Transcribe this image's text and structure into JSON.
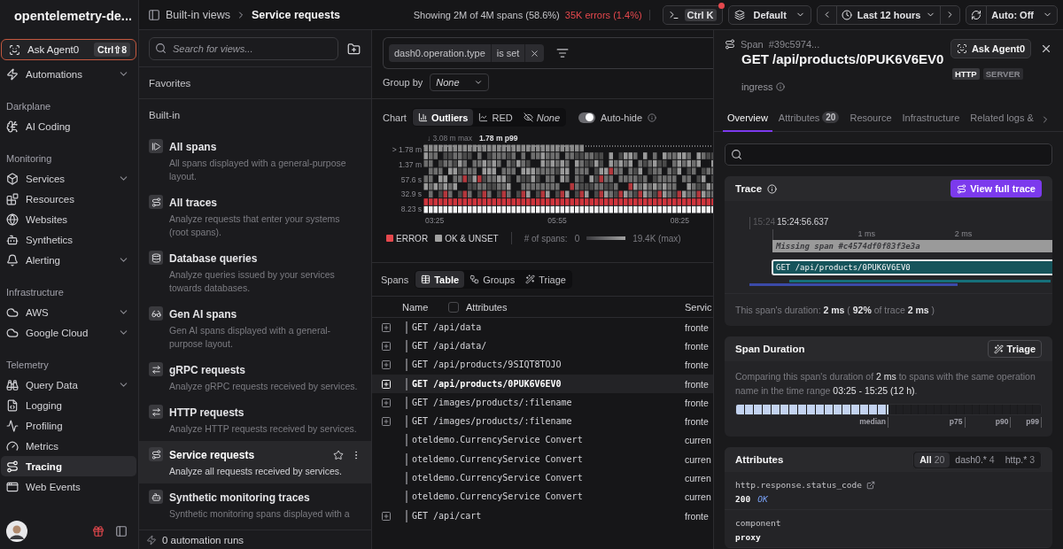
{
  "app": {
    "name": "opentelemetry-de..."
  },
  "sidebar": {
    "ask": {
      "label": "Ask Agent0",
      "shortcut": "Ctrl⇧8"
    },
    "top_items": [
      {
        "label": "Automations",
        "collapsible": true,
        "selected": false
      }
    ],
    "sections": [
      {
        "title": "Darkplane",
        "items": [
          {
            "label": "AI Coding",
            "collapsible": false,
            "selected": false
          }
        ]
      },
      {
        "title": "Monitoring",
        "items": [
          {
            "label": "Services",
            "collapsible": true,
            "selected": false
          },
          {
            "label": "Resources",
            "collapsible": false,
            "selected": false
          },
          {
            "label": "Websites",
            "collapsible": false,
            "selected": false
          },
          {
            "label": "Synthetics",
            "collapsible": false,
            "selected": false
          },
          {
            "label": "Alerting",
            "collapsible": true,
            "selected": false
          }
        ]
      },
      {
        "title": "Infrastructure",
        "items": [
          {
            "label": "AWS",
            "collapsible": true,
            "selected": false
          },
          {
            "label": "Google Cloud",
            "collapsible": true,
            "selected": false
          }
        ]
      },
      {
        "title": "Telemetry",
        "items": [
          {
            "label": "Query Data",
            "collapsible": true,
            "selected": false
          },
          {
            "label": "Logging",
            "collapsible": false,
            "selected": false
          },
          {
            "label": "Profiling",
            "collapsible": false,
            "selected": false
          },
          {
            "label": "Metrics",
            "collapsible": false,
            "selected": false
          },
          {
            "label": "Tracing",
            "collapsible": false,
            "selected": true
          },
          {
            "label": "Web Events",
            "collapsible": false,
            "selected": false
          }
        ]
      }
    ]
  },
  "breadcrumb": [
    "Built-in views",
    "Service requests"
  ],
  "stats": {
    "showing": "Showing 2M of 4M spans (58.6%)",
    "errors": "35K errors (1.4%)"
  },
  "toolbar": {
    "command": "Ctrl K",
    "view": "Default",
    "time_range": "Last 12 hours",
    "refresh": "Auto: Off"
  },
  "views": {
    "search": {
      "placeholder": "Search for views..."
    },
    "favorites_title": "Favorites",
    "builtin_title": "Built-in",
    "items": [
      {
        "title": "All spans",
        "description": "All spans displayed with a general-purpose layout.",
        "selected": false
      },
      {
        "title": "All traces",
        "description": "Analyze requests that enter your systems (root spans).",
        "selected": false
      },
      {
        "title": "Database queries",
        "description": "Analyze queries issued by your services towards databases.",
        "selected": false
      },
      {
        "title": "Gen AI spans",
        "description": "Gen AI spans displayed with a general-purpose layout.",
        "selected": false
      },
      {
        "title": "gRPC requests",
        "description": "Analyze gRPC requests received by services.",
        "selected": false
      },
      {
        "title": "HTTP requests",
        "description": "Analyze HTTP requests received by services.",
        "selected": false
      },
      {
        "title": "Service requests",
        "description": "Analyze all requests received by services.",
        "selected": true
      },
      {
        "title": "Synthetic monitoring traces",
        "description": "Synthetic monitoring spans displayed with a",
        "selected": false
      }
    ],
    "footer": "0 automation runs"
  },
  "filter": {
    "key": "dash0.operation.type",
    "op": "is set"
  },
  "group_by": {
    "label": "Group by",
    "value": "None"
  },
  "chart": {
    "label": "Chart",
    "modes": [
      {
        "label": "Outliers",
        "selected": true
      },
      {
        "label": "RED",
        "selected": false
      },
      {
        "label": "None",
        "selected": false
      }
    ],
    "auto_hide": {
      "label": "Auto-hide",
      "on": true
    }
  },
  "heatmap": {
    "max": "↓ 3.08 m max",
    "p99": "1.78 m p99",
    "y_labels": [
      "> 1.78 m",
      "1.37 m",
      "57.6 s",
      "32.9 s",
      "8.23 s"
    ],
    "x_labels": [
      "03:25",
      "05:55",
      "08:25"
    ],
    "legend": [
      {
        "label": "ERROR",
        "color": "#e5484d"
      },
      {
        "label": "OK & UNSET",
        "color": "#a1a1a1"
      }
    ],
    "count_label": "# of spans:",
    "count_min": "0",
    "count_max": "19.4K (max)"
  },
  "spans": {
    "label": "Spans",
    "views": [
      {
        "label": "Table",
        "selected": true
      },
      {
        "label": "Groups",
        "selected": false
      },
      {
        "label": "Triage",
        "selected": false
      }
    ],
    "columns": [
      "Name",
      "Attributes",
      "Servic"
    ],
    "attributes_checked": false,
    "rows": [
      {
        "name": "GET /api/data",
        "service": "fronte",
        "expandable": true,
        "selected": false
      },
      {
        "name": "GET /api/data/",
        "service": "fronte",
        "expandable": true,
        "selected": false
      },
      {
        "name": "GET /api/products/9SIQT8TOJO",
        "service": "fronte",
        "expandable": true,
        "selected": false
      },
      {
        "name": "GET /api/products/0PUK6V6EV0",
        "service": "fronte",
        "expandable": true,
        "selected": true
      },
      {
        "name": "GET /images/products/:filename",
        "service": "fronte",
        "expandable": true,
        "selected": false
      },
      {
        "name": "GET /images/products/:filename",
        "service": "fronte",
        "expandable": true,
        "selected": false
      },
      {
        "name": "oteldemo.CurrencyService Convert",
        "service": "curren",
        "expandable": false,
        "selected": false
      },
      {
        "name": "oteldemo.CurrencyService Convert",
        "service": "curren",
        "expandable": false,
        "selected": false
      },
      {
        "name": "oteldemo.CurrencyService Convert",
        "service": "curren",
        "expandable": false,
        "selected": false
      },
      {
        "name": "oteldemo.CurrencyService Convert",
        "service": "curren",
        "expandable": false,
        "selected": false
      },
      {
        "name": "GET /api/cart",
        "service": "fronte",
        "expandable": true,
        "selected": false
      }
    ]
  },
  "detail": {
    "kind_label": "Span",
    "id": "#39c5974...",
    "ask": "Ask Agent0",
    "title": "GET /api/products/0PUK6V6EV0",
    "subtitle": "ingress",
    "tags": [
      {
        "label": "HTTP",
        "strong": true
      },
      {
        "label": "SERVER",
        "strong": false
      }
    ],
    "tabs": [
      {
        "label": "Overview",
        "selected": true
      },
      {
        "label": "Attributes",
        "count": "20",
        "selected": false
      },
      {
        "label": "Resource",
        "selected": false
      },
      {
        "label": "Infrastructure",
        "selected": false
      },
      {
        "label": "Related logs &",
        "selected": false
      }
    ],
    "trace": {
      "title": "Trace",
      "button": "View full trace",
      "start_short": "15:24",
      "start": "15:24:56.637",
      "ticks": [
        "1 ms",
        "2 ms"
      ],
      "missing": "Missing span #c4574df0f83f3e3a",
      "span": "GET /api/products/0PUK6V6EV0",
      "summary": "This span's duration: **2 ms** ( **92%** of trace **2 ms** )"
    },
    "duration": {
      "title": "Span Duration",
      "button": "Triage",
      "text": "Comparing this span's duration of **2 ms** to spans with the same operation name in the time range **03:25 - 15:25 (12 h)**.",
      "level": 0.5,
      "markers": [
        "median",
        "p75",
        "p90",
        "p99"
      ]
    },
    "attributes": {
      "title": "Attributes",
      "filters": [
        {
          "label": "All",
          "count": "20",
          "selected": true
        },
        {
          "label": "dash0.*",
          "count": "4",
          "selected": false
        },
        {
          "label": "http.*",
          "count": "3",
          "selected": false
        }
      ],
      "items": [
        {
          "key": "http.response.status_code",
          "value": "200",
          "note": "OK",
          "link": true
        },
        {
          "key": "component",
          "value": "proxy",
          "link": false
        }
      ]
    }
  }
}
